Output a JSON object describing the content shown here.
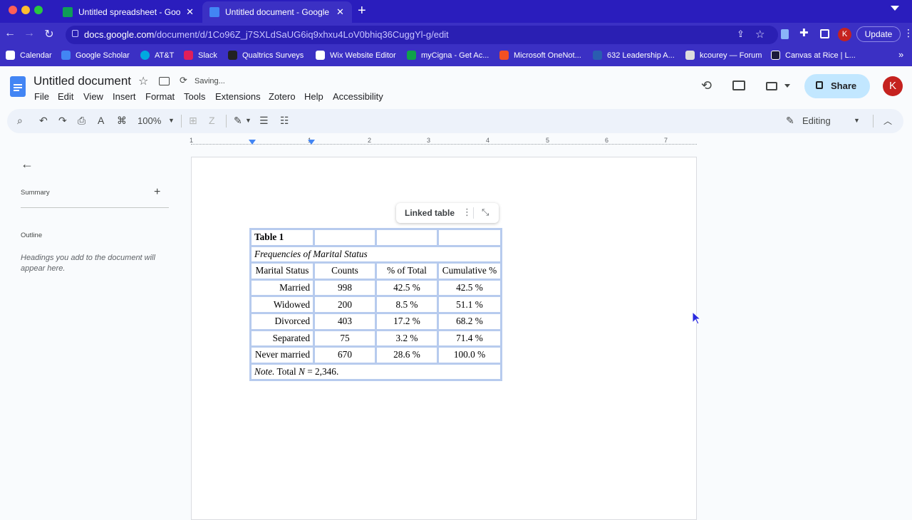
{
  "browser": {
    "tabs": [
      {
        "label": "Untitled spreadsheet - Google",
        "icon": "sheets-icon",
        "active": false
      },
      {
        "label": "Untitled document - Google D",
        "icon": "docs-icon",
        "active": true
      }
    ],
    "new_tab": "+",
    "url_domain": "docs.google.com",
    "url_path": "/document/d/1Co96Z_j7SXLdSaUG6iq9xhxu4LoV0bhiq36CuggYl-g/edit",
    "profile_initial": "K",
    "update_label": "Update",
    "bookmarks": [
      {
        "label": "Calendar",
        "color": "#ffffff"
      },
      {
        "label": "Google Scholar",
        "color": "#4285f4"
      },
      {
        "label": "AT&T",
        "color": "#00a8e0"
      },
      {
        "label": "Slack",
        "color": "#e01e5a"
      },
      {
        "label": "Qualtrics Surveys",
        "color": "#222222"
      },
      {
        "label": "Wix Website Editor",
        "color": "#ffffff"
      },
      {
        "label": "myCigna - Get Ac...",
        "color": "#0fa14a"
      },
      {
        "label": "Microsoft OneNot...",
        "color": "#7719aa"
      },
      {
        "label": "632 Leadership A...",
        "color": "#2a5db0"
      },
      {
        "label": "kcourey — Forum",
        "color": "#dddddd"
      },
      {
        "label": "Canvas at Rice | L...",
        "color": "#1a1a3a"
      }
    ],
    "more": "»"
  },
  "docs": {
    "title": "Untitled document",
    "saving_status": "Saving...",
    "menu": [
      "File",
      "Edit",
      "View",
      "Insert",
      "Format",
      "Tools",
      "Extensions",
      "Zotero",
      "Help",
      "Accessibility"
    ],
    "share_label": "Share",
    "avatar_initial": "K",
    "zoom": "100%",
    "mode": "Editing"
  },
  "ruler": [
    "1",
    "1",
    "2",
    "3",
    "4",
    "5",
    "6",
    "7"
  ],
  "outline_panel": {
    "summary_label": "Summary",
    "outline_label": "Outline",
    "hint": "Headings you add to the document will appear here."
  },
  "linked_table": {
    "label": "Linked table"
  },
  "table": {
    "title": "Table 1",
    "subtitle": "Frequencies of Marital Status",
    "headers": [
      "Marital Status",
      "Counts",
      "% of Total",
      "Cumulative %"
    ],
    "rows": [
      [
        "Married",
        "998",
        "42.5 %",
        "42.5 %"
      ],
      [
        "Widowed",
        "200",
        "8.5 %",
        "51.1 %"
      ],
      [
        "Divorced",
        "403",
        "17.2 %",
        "68.2 %"
      ],
      [
        "Separated",
        "75",
        "3.2 %",
        "71.4 %"
      ],
      [
        "Never married",
        "670",
        "28.6 %",
        "100.0 %"
      ]
    ],
    "note_prefix": "Note.",
    "note_mid": " Total ",
    "note_var": "N",
    "note_value": " = 2,346."
  },
  "colors": {
    "chrome": "#3b30c4",
    "share_bg": "#c2e7ff",
    "avatar": "#c5221f",
    "table_border": "#b7cbee"
  }
}
